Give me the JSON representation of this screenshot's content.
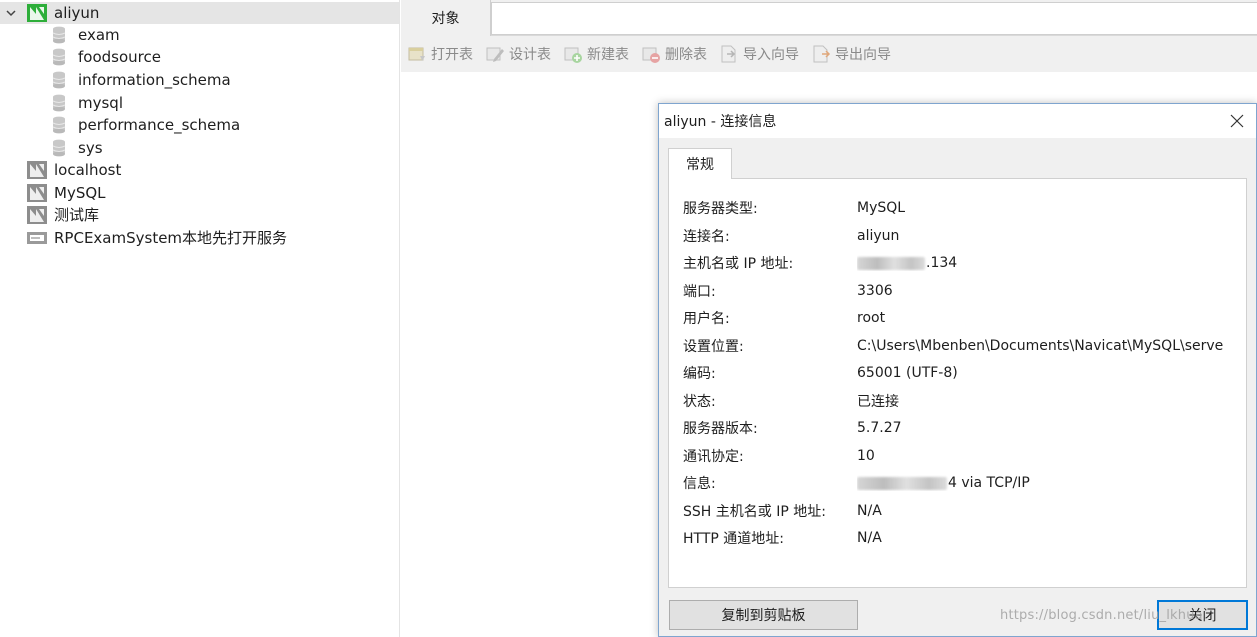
{
  "tree": {
    "connections": [
      {
        "label": "aliyun",
        "expanded": true,
        "selected": true,
        "connected": true
      },
      {
        "label": "localhost",
        "expanded": false,
        "connected": false
      },
      {
        "label": "MySQL",
        "expanded": false,
        "connected": false
      },
      {
        "label": "测试库",
        "expanded": false,
        "connected": false
      },
      {
        "label": "RPCExamSystem本地先打开服务",
        "expanded": false,
        "connected": false
      }
    ],
    "databases": [
      "exam",
      "foodsource",
      "information_schema",
      "mysql",
      "performance_schema",
      "sys"
    ]
  },
  "tabs": {
    "objects_label": "对象"
  },
  "toolbar": {
    "open_table": "打开表",
    "design_table": "设计表",
    "new_table": "新建表",
    "delete_table": "删除表",
    "import_wizard": "导入向导",
    "export_wizard": "导出向导"
  },
  "dialog": {
    "title": "aliyun - 连接信息",
    "tab_general": "常规",
    "rows": [
      {
        "key": "服务器类型:",
        "value": "MySQL"
      },
      {
        "key": "连接名:",
        "value": "aliyun"
      },
      {
        "key": "主机名或 IP 地址:",
        "value": ".134"
      },
      {
        "key": "端口:",
        "value": "3306"
      },
      {
        "key": "用户名:",
        "value": "root"
      },
      {
        "key": "设置位置:",
        "value": "C:\\Users\\Mbenben\\Documents\\Navicat\\MySQL\\servers\\aliyun"
      },
      {
        "key": "编码:",
        "value": "65001 (UTF-8)"
      },
      {
        "key": "状态:",
        "value": "已连接"
      },
      {
        "key": "服务器版本:",
        "value": "5.7.27"
      },
      {
        "key": "通讯协定:",
        "value": "10"
      },
      {
        "key": "信息:",
        "value": "4 via TCP/IP"
      },
      {
        "key": "SSH 主机名或 IP 地址:",
        "value": "N/A"
      },
      {
        "key": "HTTP 通道地址:",
        "value": "N/A"
      }
    ],
    "copy_button": "复制到剪贴板",
    "close_button": "关闭"
  },
  "watermark": "https://blog.csdn.net/liu_lkhua",
  "colors": {
    "connected_icon": "#2eae3a",
    "disconnected_icon": "#8d8d8d",
    "selection": "#e5e5e5",
    "dialog_border": "#7fa5cf",
    "default_button_border": "#0078d7"
  }
}
